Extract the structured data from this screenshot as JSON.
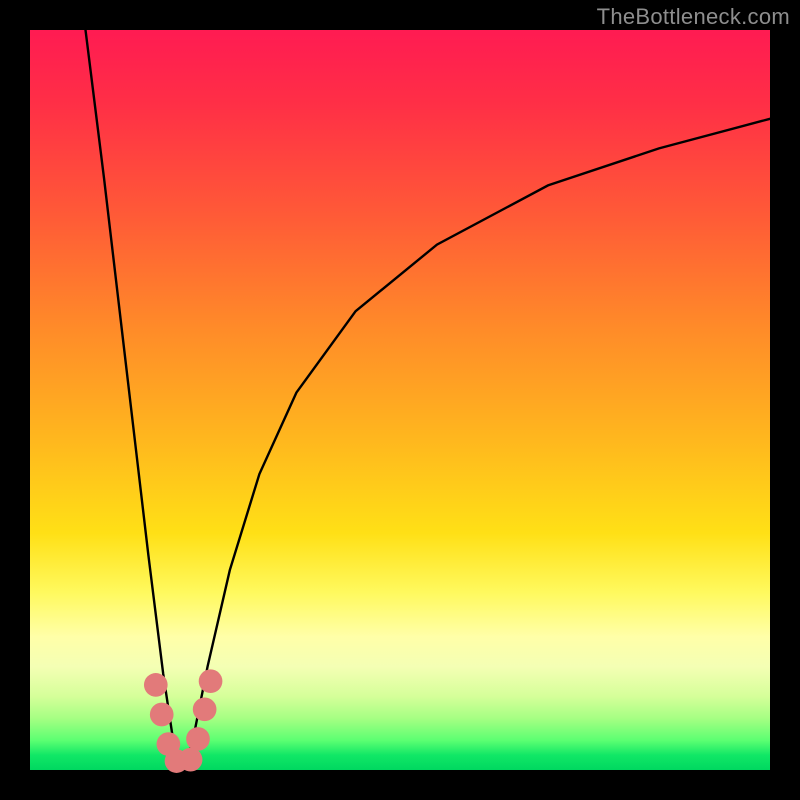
{
  "watermark_text": "TheBottleneck.com",
  "colors": {
    "page_bg": "#000000",
    "curve_stroke": "#000000",
    "marker_fill": "#e27a7a",
    "gradient_top": "#ff1b52",
    "gradient_bottom": "#00d860",
    "watermark": "#8e8e8e"
  },
  "chart_data": {
    "type": "line",
    "title": "",
    "xlabel": "",
    "ylabel": "",
    "xlim": [
      0,
      100
    ],
    "ylim": [
      0,
      100
    ],
    "note": "Axes are unlabeled; values are percentages of plot area. y=0 is the bottom (green/good), y=100 is the top (red/bad). The two curves form a V with the minimum near x≈20.",
    "series": [
      {
        "name": "left-curve",
        "x": [
          7.5,
          10,
          12,
          14,
          16,
          18,
          19.5,
          20
        ],
        "y": [
          100,
          80,
          63,
          46,
          29,
          13,
          3,
          0.5
        ]
      },
      {
        "name": "right-curve",
        "x": [
          21,
          22,
          24,
          27,
          31,
          36,
          44,
          55,
          70,
          85,
          100
        ],
        "y": [
          0.5,
          4,
          14,
          27,
          40,
          51,
          62,
          71,
          79,
          84,
          88
        ]
      }
    ],
    "markers": [
      {
        "name": "left-marker-1",
        "x": 17.0,
        "y": 11.5
      },
      {
        "name": "left-marker-2",
        "x": 17.8,
        "y": 7.5
      },
      {
        "name": "left-marker-3",
        "x": 18.7,
        "y": 3.5
      },
      {
        "name": "left-marker-4",
        "x": 19.8,
        "y": 1.2
      },
      {
        "name": "right-marker-1",
        "x": 21.7,
        "y": 1.4
      },
      {
        "name": "right-marker-2",
        "x": 22.7,
        "y": 4.2
      },
      {
        "name": "right-marker-3",
        "x": 23.6,
        "y": 8.2
      },
      {
        "name": "right-marker-4",
        "x": 24.4,
        "y": 12.0
      }
    ],
    "marker_radius_pct": 1.6
  }
}
